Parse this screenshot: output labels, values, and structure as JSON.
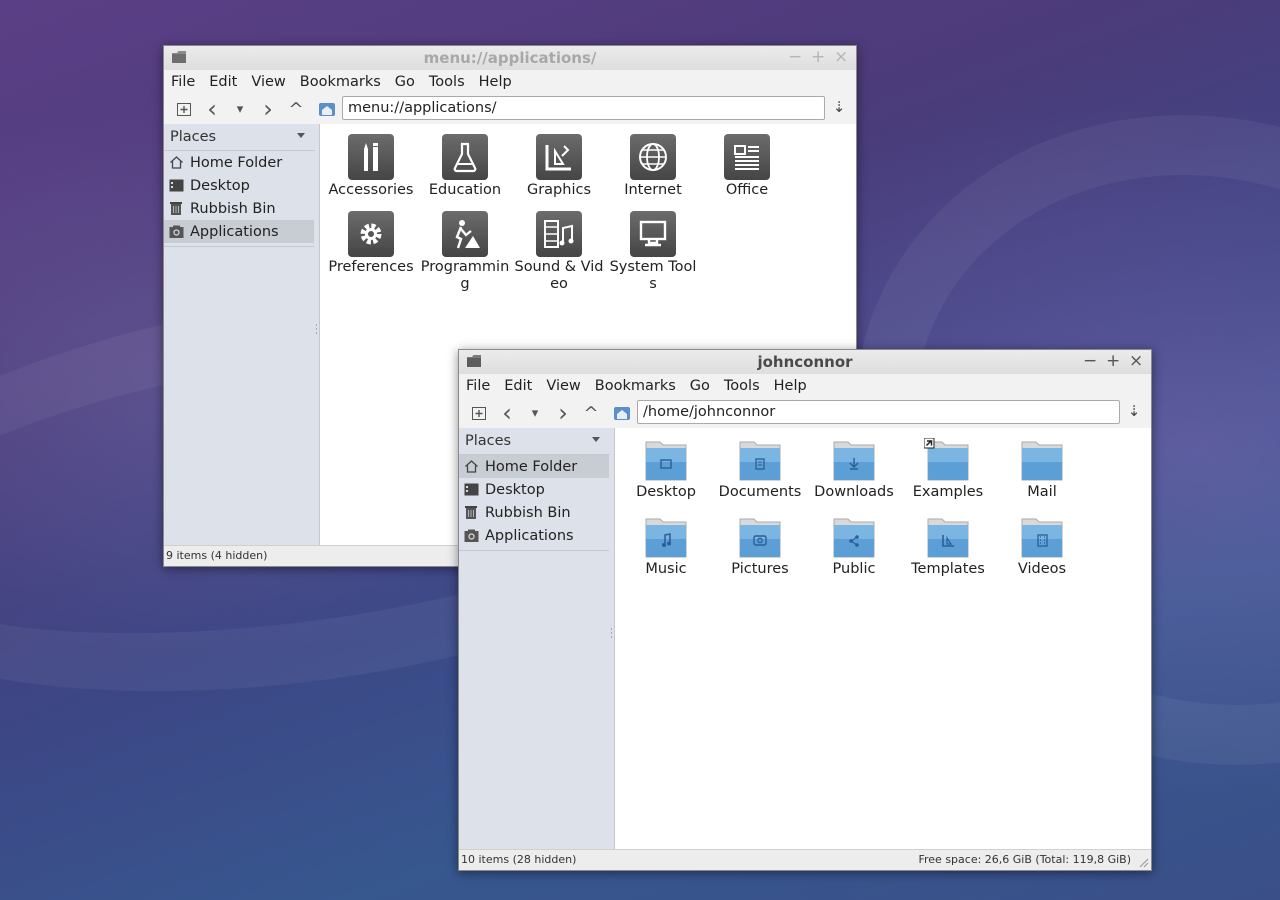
{
  "windows": {
    "apps": {
      "title": "menu://applications/",
      "address": "menu://applications/",
      "status": "9 items (4 hidden)"
    },
    "home": {
      "title": "johnconnor",
      "address": "/home/johnconnor",
      "status_left": "10 items (28 hidden)",
      "status_right": "Free space: 26,6 GiB (Total: 119,8 GiB)"
    }
  },
  "menu": {
    "file": "File",
    "edit": "Edit",
    "view": "View",
    "bookmarks": "Bookmarks",
    "go": "Go",
    "tools": "Tools",
    "help": "Help"
  },
  "window_controls": {
    "minimize": "−",
    "maximize": "+",
    "close": "×"
  },
  "toolbar_glyphs": {
    "back": "‹",
    "history": "▾",
    "forward": "›",
    "up": "^",
    "go": "⇣"
  },
  "places": {
    "header": "Places",
    "items": [
      "Home Folder",
      "Desktop",
      "Rubbish Bin",
      "Applications"
    ]
  },
  "app_categories": [
    "Accessories",
    "Education",
    "Graphics",
    "Internet",
    "Office",
    "Preferences",
    "Programming",
    "Sound & Video",
    "System Tools"
  ],
  "home_folders": [
    "Desktop",
    "Documents",
    "Downloads",
    "Examples",
    "Mail",
    "Music",
    "Pictures",
    "Public",
    "Templates",
    "Videos"
  ],
  "folder_color": "#5b9fd6",
  "app_icon_color": "#555555",
  "icons": {
    "apps": [
      "accessories-icon",
      "education-icon",
      "graphics-icon",
      "internet-icon",
      "office-icon",
      "preferences-icon",
      "programming-icon",
      "sound-video-icon",
      "system-tools-icon"
    ],
    "places": [
      "home-icon",
      "desktop-icon",
      "rubbish-bin-icon",
      "applications-icon"
    ]
  }
}
